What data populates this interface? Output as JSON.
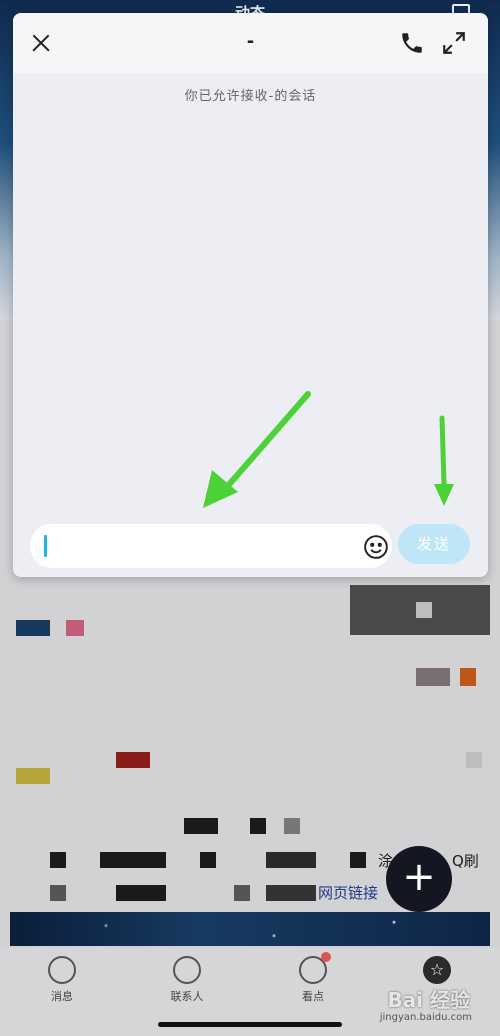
{
  "background": {
    "title": "动态",
    "partial_texts": [
      "涂",
      "Q刷",
      "网页链接"
    ]
  },
  "fab": {
    "label": "+"
  },
  "tabbar": {
    "items": [
      {
        "label": "消息",
        "icon": "message-icon"
      },
      {
        "label": "联系人",
        "icon": "contacts-icon"
      },
      {
        "label": "看点",
        "icon": "eye-icon",
        "badge": true
      },
      {
        "label": "",
        "icon": "star-icon"
      }
    ]
  },
  "watermark": {
    "text": "Bai 经验",
    "url": "jingyan.baidu.com"
  },
  "chat": {
    "title": "-",
    "system_message": "你已允许接收-的会话",
    "input_value": "",
    "input_placeholder": "",
    "send_label": "发送"
  },
  "colors": {
    "accent": "#1fb6e6",
    "send_bg": "#bfe6f7",
    "annotation": "#4cd137"
  }
}
